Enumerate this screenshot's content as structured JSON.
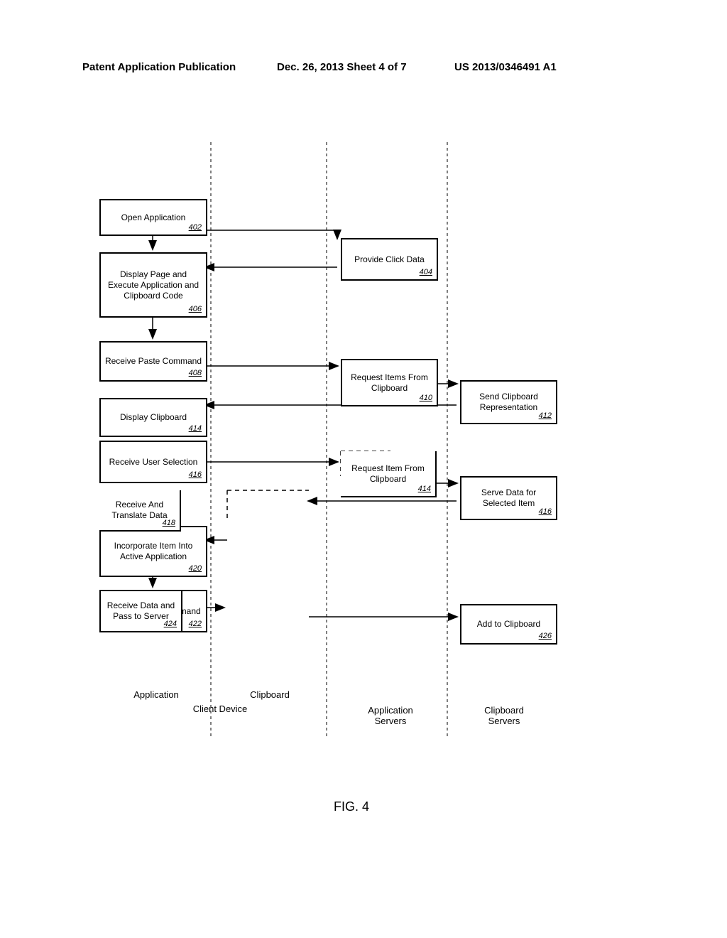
{
  "header": {
    "left": "Patent Application Publication",
    "center": "Dec. 26, 2013  Sheet 4 of 7",
    "right": "US 2013/0346491 A1"
  },
  "boxes": {
    "b402": {
      "text": "Open Application",
      "num": "402"
    },
    "b404": {
      "text": "Provide Click Data",
      "num": "404"
    },
    "b406": {
      "text": "Display Page and Execute Application and Clipboard Code",
      "num": "406"
    },
    "b408": {
      "text": "Receive Paste Command",
      "num": "408"
    },
    "b410": {
      "text": "Request Items From Clipboard",
      "num": "410"
    },
    "b412": {
      "text": "Send Clipboard Representation",
      "num": "412"
    },
    "b414a": {
      "text": "Display Clipboard",
      "num": "414"
    },
    "b416a": {
      "text": "Receive User Selection",
      "num": "416"
    },
    "b414b": {
      "text": "Request Item From Clipboard",
      "num": "414"
    },
    "b416b": {
      "text": "Serve Data for Selected Item",
      "num": "416"
    },
    "b418": {
      "text": "Receive And Translate Data",
      "num": "418"
    },
    "b420": {
      "text": "Incorporate Item Into Active Application",
      "num": "420"
    },
    "b422": {
      "text": "Receive Copy Command",
      "num": "422"
    },
    "b424": {
      "text": "Receive Data and Pass to Server",
      "num": "424"
    },
    "b426": {
      "text": "Add to Clipboard",
      "num": "426"
    }
  },
  "lanes": {
    "app": "Application",
    "clip": "Clipboard",
    "client": "Client Device",
    "appservers": "Application Servers",
    "clipservers": "Clipboard Servers"
  },
  "figure": "FIG. 4"
}
